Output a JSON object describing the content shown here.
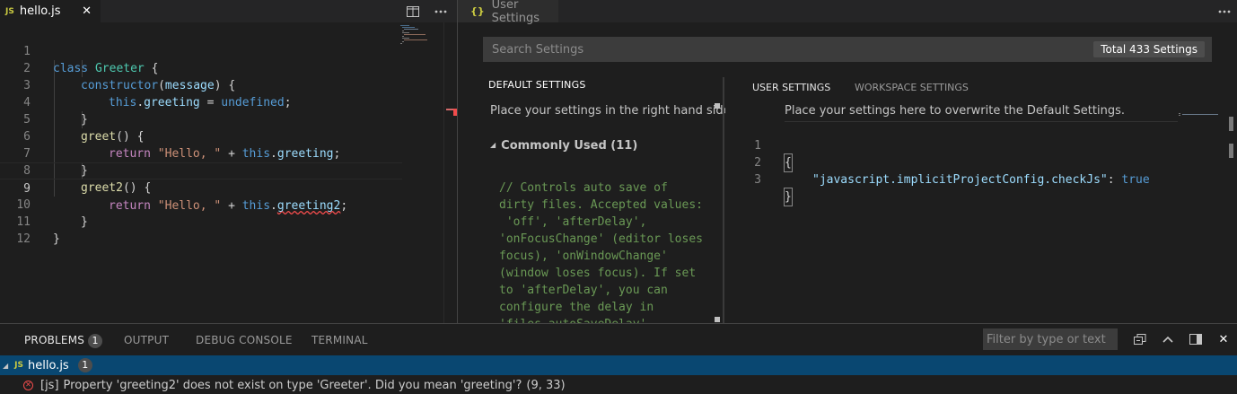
{
  "left_editor": {
    "tab": {
      "badge": "JS",
      "filename": "hello.js",
      "close": "✕"
    },
    "lines": [
      "1",
      "2",
      "3",
      "4",
      "5",
      "6",
      "7",
      "8",
      "9",
      "10",
      "11",
      "12"
    ],
    "code": {
      "l1": [
        "class",
        " ",
        "Greeter",
        " {"
      ],
      "l2": [
        "constructor",
        "(",
        "message",
        ") {"
      ],
      "l3": [
        "this",
        ".",
        "greeting",
        " = ",
        "undefined",
        ";"
      ],
      "l4": [
        "}"
      ],
      "l5": [
        "greet",
        "() {"
      ],
      "l6": [
        "return",
        " ",
        "\"Hello, \"",
        " + ",
        "this",
        ".",
        "greeting",
        ";"
      ],
      "l7": [
        "}"
      ],
      "l8": [
        "greet2",
        "() {"
      ],
      "l9": [
        "return",
        " ",
        "\"Hello, \"",
        " + ",
        "this",
        ".",
        "greeting2",
        ";"
      ],
      "l10": [
        "}"
      ],
      "l11": [
        "}"
      ]
    }
  },
  "right_editor": {
    "tab": {
      "icon": "{}",
      "title": "User Settings"
    },
    "search": {
      "placeholder": "Search Settings",
      "count": "Total 433 Settings"
    },
    "default_settings": {
      "header": "DEFAULT SETTINGS",
      "description": "Place your settings in the right hand side editor to override.",
      "group": "Commonly Used (11)",
      "comment": "// Controls auto save of\ndirty files. Accepted values:\n 'off', 'afterDelay',\n'onFocusChange' (editor loses\nfocus), 'onWindowChange'\n(window loses focus). If set\nto 'afterDelay', you can\nconfigure the delay in\n'files.autoSaveDelay'."
    },
    "user_settings": {
      "tab_user": "USER SETTINGS",
      "tab_workspace": "WORKSPACE SETTINGS",
      "description": "Place your settings here to overwrite the Default Settings.",
      "lines": [
        "1",
        "2",
        "3"
      ],
      "open_brace": "{",
      "key": "\"javascript.implicitProjectConfig.checkJs\"",
      "colon": ": ",
      "value": "true",
      "close_brace": "}"
    }
  },
  "panel": {
    "tabs": {
      "problems": "PROBLEMS",
      "problems_count": "1",
      "output": "OUTPUT",
      "debug": "DEBUG CONSOLE",
      "terminal": "TERMINAL"
    },
    "filter_placeholder": "Filter by type or text",
    "file": {
      "badge": "JS",
      "name": "hello.js",
      "count": "1"
    },
    "problem": {
      "source": "[js]",
      "message": "Property 'greeting2' does not exist on type 'Greeter'. Did you mean 'greeting'?",
      "location": "(9, 33)"
    }
  },
  "colors": {
    "keyword": "#569cd6",
    "class": "#4ec9b0",
    "function": "#dcdcaa",
    "property": "#9cdcfe",
    "string": "#ce9178",
    "comment": "#6a9955",
    "error": "#f14c4c",
    "selection": "#094771"
  }
}
